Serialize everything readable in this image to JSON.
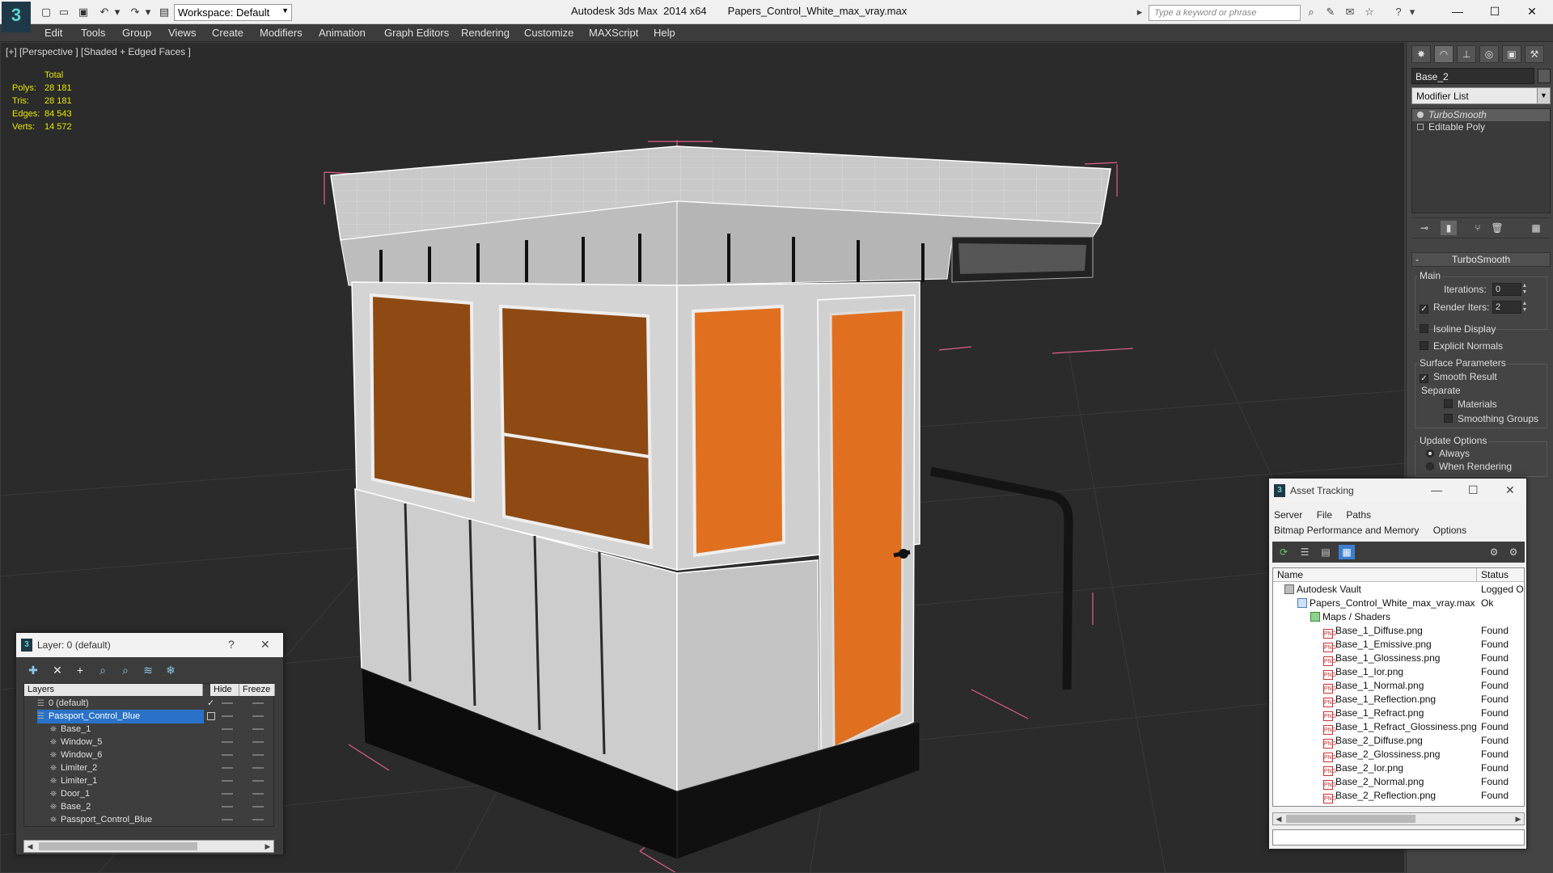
{
  "titlebar": {
    "logo_text": "3",
    "workspace": "Workspace: Default",
    "app_title": "Autodesk 3ds Max  2014 x64",
    "file_title": "Papers_Control_White_max_vray.max",
    "search_placeholder": "Type a keyword or phrase"
  },
  "menu": [
    "Edit",
    "Tools",
    "Group",
    "Views",
    "Create",
    "Modifiers",
    "Animation",
    "Graph Editors",
    "Rendering",
    "Customize",
    "MAXScript",
    "Help"
  ],
  "viewport": {
    "label": "[+] [Perspective ] [Shaded + Edged Faces ]",
    "stats_header": "Total",
    "stats": [
      {
        "k": "Polys:",
        "v": "28 181"
      },
      {
        "k": "Tris:",
        "v": "28 181"
      },
      {
        "k": "Edges:",
        "v": "84 543"
      },
      {
        "k": "Verts:",
        "v": "14 572"
      }
    ]
  },
  "command_panel": {
    "object_name": "Base_2",
    "modifier_list": "Modifier List",
    "stack": [
      "TurboSmooth",
      "Editable Poly"
    ],
    "rollout": "TurboSmooth",
    "main_group": "Main",
    "iterations_label": "Iterations:",
    "iterations_value": "0",
    "render_iters_label": "Render Iters:",
    "render_iters_value": "2",
    "isoline": "Isoline Display",
    "explicit_normals": "Explicit Normals",
    "surface_group": "Surface Parameters",
    "smooth_result": "Smooth Result",
    "separate": "Separate",
    "materials": "Materials",
    "smoothing_groups": "Smoothing Groups",
    "update_group": "Update Options",
    "always": "Always",
    "when_rendering": "When Rendering"
  },
  "layer_window": {
    "title": "Layer: 0 (default)",
    "help": "?",
    "col_layers": "Layers",
    "col_hide": "Hide",
    "col_freeze": "Freeze",
    "rows": [
      "0 (default)",
      "Passport_Control_Blue",
      "Base_1",
      "Window_5",
      "Window_6",
      "Limiter_2",
      "Limiter_1",
      "Door_1",
      "Base_2",
      "Passport_Control_Blue"
    ]
  },
  "asset_window": {
    "title": "Asset Tracking",
    "menu1": [
      "Server",
      "File",
      "Paths"
    ],
    "menu2": [
      "Bitmap Performance and Memory",
      "Options"
    ],
    "col_name": "Name",
    "col_status": "Status",
    "rows": [
      {
        "name": "Autodesk Vault",
        "status": "Logged O"
      },
      {
        "name": "Papers_Control_White_max_vray.max",
        "status": "Ok"
      },
      {
        "name": "Maps / Shaders",
        "status": ""
      },
      {
        "name": "Base_1_Diffuse.png",
        "status": "Found"
      },
      {
        "name": "Base_1_Emissive.png",
        "status": "Found"
      },
      {
        "name": "Base_1_Glossiness.png",
        "status": "Found"
      },
      {
        "name": "Base_1_Ior.png",
        "status": "Found"
      },
      {
        "name": "Base_1_Normal.png",
        "status": "Found"
      },
      {
        "name": "Base_1_Reflection.png",
        "status": "Found"
      },
      {
        "name": "Base_1_Refract.png",
        "status": "Found"
      },
      {
        "name": "Base_1_Refract_Glossiness.png",
        "status": "Found"
      },
      {
        "name": "Base_2_Diffuse.png",
        "status": "Found"
      },
      {
        "name": "Base_2_Glossiness.png",
        "status": "Found"
      },
      {
        "name": "Base_2_Ior.png",
        "status": "Found"
      },
      {
        "name": "Base_2_Normal.png",
        "status": "Found"
      },
      {
        "name": "Base_2_Reflection.png",
        "status": "Found"
      }
    ]
  },
  "colors": {
    "accent_orange": "#e07020",
    "selection_blue": "#2a72c9",
    "stats_yellow": "#e6e600"
  }
}
